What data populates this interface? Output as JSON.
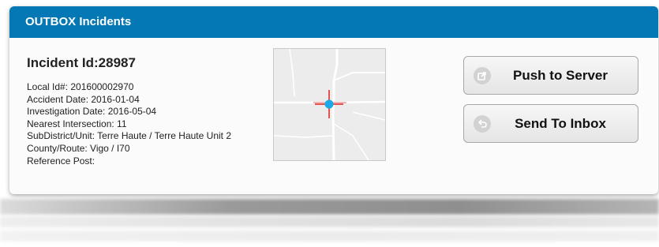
{
  "panel": {
    "title": "OUTBOX Incidents"
  },
  "incident": {
    "title": "Incident Id:28987",
    "details": [
      "Local Id#: 201600002970",
      "Accident Date: 2016-01-04",
      "Investigation Date: 2016-05-04",
      "Nearest Intersection: 11",
      "SubDistrict/Unit: Terre Haute / Terre Haute Unit 2",
      "County/Route: Vigo / I70",
      "Reference Post:"
    ]
  },
  "actions": {
    "push_label": "Push to Server",
    "push_icon": "share-icon",
    "send_label": "Send To Inbox",
    "send_icon": "return-arrow-icon"
  },
  "colors": {
    "header": "#0478b4",
    "marker": "#19a9e8",
    "crosshair": "#e0201c"
  }
}
